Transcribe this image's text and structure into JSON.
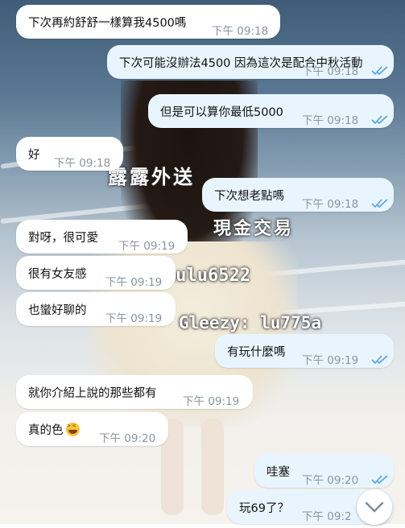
{
  "chat": {
    "messages": [
      {
        "side": "in",
        "text": "下次再約舒舒一樣算我4500嗎",
        "time": "下午 09:18"
      },
      {
        "side": "out",
        "text": "下次可能沒辦法4500  因為這次是配合中秋活動",
        "time": "下午 09:18",
        "status": "read"
      },
      {
        "side": "out",
        "text": "但是可以算你最低5000",
        "time": "下午 09:18",
        "status": "read"
      },
      {
        "side": "in",
        "text": "好",
        "time": "下午 09:18"
      },
      {
        "side": "out",
        "text": "下次想老點嗎",
        "time": "下午 09:18",
        "status": "read"
      },
      {
        "side": "in",
        "text": "對呀，很可愛",
        "time": "下午 09:19"
      },
      {
        "side": "in",
        "text": "很有女友感",
        "time": "下午 09:19"
      },
      {
        "side": "in",
        "text": "也蠻好聊的",
        "time": "下午 09:19"
      },
      {
        "side": "out",
        "text": "有玩什麼嗎",
        "time": "下午 09:19",
        "status": "read"
      },
      {
        "side": "in",
        "text": "就你介紹上說的那些都有",
        "time": "下午 09:19"
      },
      {
        "side": "in",
        "text": "真的色",
        "time": "下午 09:20",
        "emoji": "grinning-squinting-face"
      },
      {
        "side": "out",
        "text": "哇塞",
        "time": "下午 09:20",
        "status": "read"
      },
      {
        "side": "out",
        "text": "玩69了？",
        "time": "下午 09:2",
        "status": "read"
      }
    ]
  },
  "watermark": {
    "line1": "露露外送",
    "line2": "現金交易",
    "line3": "lulu6522",
    "line4": "Gleezy: lu775a"
  },
  "colors": {
    "incoming_bubble": "#ffffff",
    "outgoing_bubble": "#e9f5fe",
    "read_check": "#4fa3e0",
    "time_text": "#8a94a0"
  },
  "controls": {
    "scroll_down_icon": "chevron-down-icon"
  }
}
